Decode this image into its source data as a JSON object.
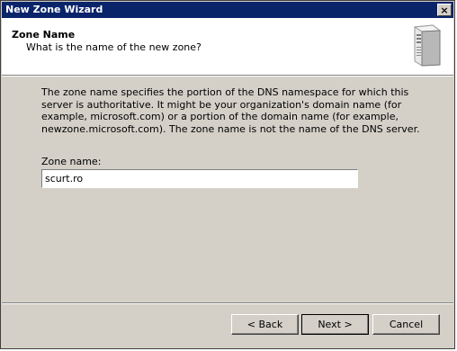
{
  "window": {
    "title": "New Zone Wizard",
    "close_symbol": "×"
  },
  "header": {
    "title": "Zone Name",
    "subtitle": "What is the name of the new zone?",
    "icon": "server-icon"
  },
  "body": {
    "description": "The zone name specifies the portion of the DNS namespace for which this server is authoritative. It might be your organization's domain name (for example,  microsoft.com) or a portion of the domain name (for example, newzone.microsoft.com). The zone name is not the name of the DNS server.",
    "zone_label": "Zone name:",
    "zone_value": "scurt.ro"
  },
  "buttons": {
    "back": "< Back",
    "next": "Next >",
    "cancel": "Cancel"
  }
}
